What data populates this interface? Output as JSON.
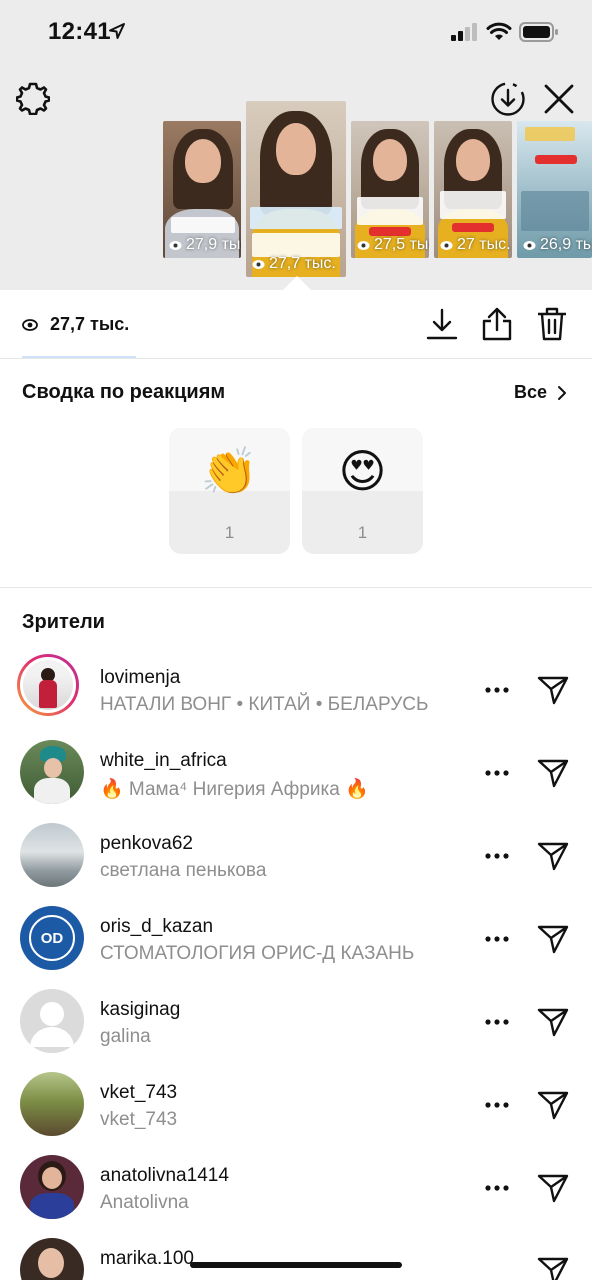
{
  "status_bar": {
    "time": "12:41",
    "location_icon": "location-arrow-icon",
    "signal_icon": "cellular-signal-icon",
    "wifi_icon": "wifi-icon",
    "battery_icon": "battery-icon"
  },
  "header": {
    "settings_icon": "gear-icon",
    "save_icon": "download-circle-icon",
    "close_icon": "close-icon"
  },
  "story_thumbnails": [
    {
      "views": "27,9 тыс.",
      "selected": false
    },
    {
      "views": "27,7 тыс.",
      "selected": true,
      "sticker_text": "Ваша дочь вышла замуж за нигерийца?",
      "tag": "@martasolo"
    },
    {
      "views": "27,5 тыс.",
      "selected": false,
      "tag": "@martasolo"
    },
    {
      "views": "27 тыс.",
      "selected": false,
      "tag": "@martasolo"
    },
    {
      "views": "26,9 тыс.",
      "selected": false,
      "title": "Дубай",
      "tag": "@martasolo"
    }
  ],
  "story_stats": {
    "views": "27,7 тыс.",
    "download_icon": "download-icon",
    "share_icon": "share-icon",
    "delete_icon": "trash-icon"
  },
  "reactions": {
    "title": "Сводка по реакциям",
    "see_all_label": "Все",
    "items": [
      {
        "emoji": "👏",
        "count": "1"
      },
      {
        "emoji": "😍",
        "count": "1"
      }
    ]
  },
  "viewers": {
    "title": "Зрители",
    "list": [
      {
        "username": "lovimenja",
        "name": "НАТАЛИ ВОНГ • КИТАЙ • БЕЛАРУСЬ",
        "has_story_ring": true
      },
      {
        "username": "white_in_africa",
        "name": "🔥 Мама⁴ Нигерия Африка 🔥",
        "has_story_ring": false
      },
      {
        "username": "penkova62",
        "name": "светлана пенькова",
        "has_story_ring": false
      },
      {
        "username": "oris_d_kazan",
        "name": "СТОМАТОЛОГИЯ ОРИС-Д КАЗАНЬ",
        "has_story_ring": false,
        "avatar_text": "OD"
      },
      {
        "username": "kasiginag",
        "name": "galina",
        "has_story_ring": false
      },
      {
        "username": "vket_743",
        "name": "vket_743",
        "has_story_ring": false
      },
      {
        "username": "anatolivna1414",
        "name": "Anatolivna",
        "has_story_ring": false
      },
      {
        "username": "marika.100",
        "name": "",
        "has_story_ring": false
      }
    ]
  }
}
